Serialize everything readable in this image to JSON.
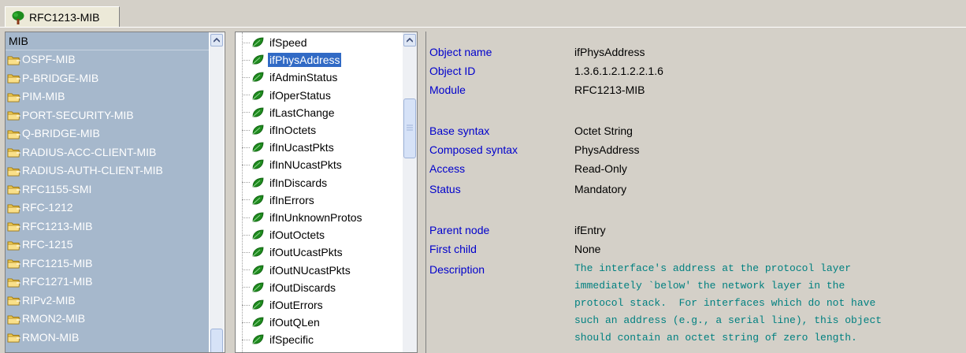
{
  "tab": {
    "label": "RFC1213-MIB"
  },
  "mib_list": {
    "header": "MIB",
    "items": [
      "OSPF-MIB",
      "P-BRIDGE-MIB",
      "PIM-MIB",
      "PORT-SECURITY-MIB",
      "Q-BRIDGE-MIB",
      "RADIUS-ACC-CLIENT-MIB",
      "RADIUS-AUTH-CLIENT-MIB",
      "RFC1155-SMI",
      "RFC-1212",
      "RFC1213-MIB",
      "RFC-1215",
      "RFC1215-MIB",
      "RFC1271-MIB",
      "RIPv2-MIB",
      "RMON2-MIB",
      "RMON-MIB"
    ]
  },
  "object_tree": {
    "selected": "ifPhysAddress",
    "items": [
      "ifSpeed",
      "ifPhysAddress",
      "ifAdminStatus",
      "ifOperStatus",
      "ifLastChange",
      "ifInOctets",
      "ifInUcastPkts",
      "ifInNUcastPkts",
      "ifInDiscards",
      "ifInErrors",
      "ifInUnknownProtos",
      "ifOutOctets",
      "ifOutUcastPkts",
      "ifOutNUcastPkts",
      "ifOutDiscards",
      "ifOutErrors",
      "ifOutQLen",
      "ifSpecific"
    ]
  },
  "details": {
    "object_name": {
      "label": "Object name",
      "value": "ifPhysAddress"
    },
    "object_id": {
      "label": "Object ID",
      "value": "1.3.6.1.2.1.2.2.1.6"
    },
    "module": {
      "label": "Module",
      "value": "RFC1213-MIB"
    },
    "base_syntax": {
      "label": "Base syntax",
      "value": "Octet String"
    },
    "composed_syntax": {
      "label": "Composed syntax",
      "value": "PhysAddress"
    },
    "access": {
      "label": "Access",
      "value": "Read-Only"
    },
    "status": {
      "label": "Status",
      "value": "Mandatory"
    },
    "parent_node": {
      "label": "Parent node",
      "value": "ifEntry"
    },
    "first_child": {
      "label": "First child",
      "value": "None"
    },
    "description": {
      "label": "Description",
      "value": "The interface's address at the protocol layer\nimmediately `below' the network layer in the\nprotocol stack.  For interfaces which do not have\nsuch an address (e.g., a serial line), this object\nshould contain an octet string of zero length."
    }
  },
  "colors": {
    "list_bg": "#a6b8cc",
    "selection": "#316ac5",
    "detail_key": "#0000cc",
    "description_text": "#008080"
  },
  "icons": {
    "tab": "tree-icon",
    "mib_item": "folder-icon",
    "object_item": "leaf-icon"
  }
}
